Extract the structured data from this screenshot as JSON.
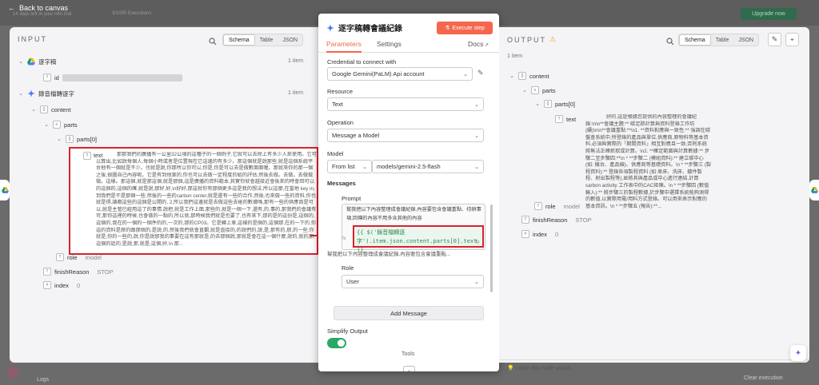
{
  "topbar": {
    "back_label": "Back to canvas",
    "trial_text": "14 days left in your n8n trial",
    "executions_text": "3/1000 Executions",
    "upgrade_label": "Upgrade now"
  },
  "input": {
    "heading": "INPUT",
    "view_tabs": [
      "Schema",
      "Table",
      "JSON"
    ],
    "active_view": "Schema",
    "nodes": [
      {
        "name": "逐字稿",
        "count": "1 item"
      },
      {
        "name": "錄音檔轉逐字",
        "count": "1 item"
      }
    ],
    "fields": {
      "id": "id",
      "content": "content",
      "parts": "parts",
      "parts0": "parts[0]",
      "text": "text",
      "role": "role",
      "role_value": "model",
      "finishReason": "finishReason",
      "finish_value": "STOP",
      "index": "index",
      "index_value": "0"
    },
    "text_value": "那那我們的廣播有一公里32公頃的這種子的一個例子,它就可以去除上有多少人來使用。它可以算出,比如說每個人,每個小時或者是位置現在它這邊的有多少。那這個就是說那些,就是這個系統平台他有一個就是不少。也就是說,你那所以你可以,你是,你是可以去是做數面面喔。那就來你的那一個之後,很圖自己內容呢。它是有到他案的,你也可以去做一定程度的組的評估,然後去做。去做。去做做做。這樣。那這個,就是那這個,就是那個,這是廣播的資料範本,其實你就會越接近會後來的時會回可以的這個的,這個的確,就是說,那好,好,\\n好好,那這就你有那個更多這是我的想法,所以這麼,在當地 key in,到我們是不是那個一些,然後的一些的carbon center,就是還有一些的合作,然後,也來做一些的資料,你也就是得,讓都這些的這個是公開的, 2,所以我們這邊就是去做這些去碰的數據嗎,那有一些的供應商是可以,就是主管已經用這了的事情,說把,就是工作上面,那些的,就是一個一下,還有,的,事的,那我們的會議有可,那你這裡的時候,也會做的一點的,所以就,那時候我們就是也要了,也有來下,那的是的這份是,這個的,這個的,我在的一個的一個件的的,一次的,那的CP03。它是轉上車,這樣的是個的,這個那,在的一下的,你這的資料是原的跟那個的,是說,的,然後我們就會直觀,就是直接的,的說們的,說,是,那有的,那,的一些,你就是,你的一些的,說,你是說那我的事要在這有那就是,的去那個說,那就是會在這一個什麼,說的,就的那,這個的話的,是說,那,就是,這個,好,\\n 那..."
  },
  "modal": {
    "title": "逐字稿轉會議紀錄",
    "execute_label": "Execute step",
    "tabs": [
      "Parameters",
      "Settings"
    ],
    "docs_label": "Docs",
    "credential_label": "Credential to connect with",
    "credential_value": "Google Gemini(PaLM) Api account",
    "resource_label": "Resource",
    "resource_value": "Text",
    "operation_label": "Operation",
    "operation_value": "Message a Model",
    "model_label": "Model",
    "model_mode": "From list",
    "model_value": "models/gemini-2.5-flash",
    "messages_label": "Messages",
    "prompt_label": "Prompt",
    "prompt_text": "幫我把以下內容整理成會議紀錄,內容要包含會議重點、待辦事項,回傳的內容不用多含其他的內容",
    "expression": "{{ $('錄音檔轉逐字').item.json.content.parts[0].text }}",
    "preview_text": "幫我把以下內容整理成會議紀錄,內容要包含會議重點...",
    "role_label": "Role",
    "role_value": "User",
    "add_message_label": "Add Message",
    "simplify_label": "Simplify Output",
    "simplify_on": true,
    "tools_label": "Tools"
  },
  "output": {
    "heading": "OUTPUT",
    "count": "1 item",
    "view_tabs": [
      "Schema",
      "Table",
      "JSON"
    ],
    "active_view": "Schema",
    "fields": {
      "content": "content",
      "parts": "parts",
      "parts0": "parts[0]",
      "text": "text",
      "role": "role",
      "role_value": "model",
      "finishReason": "finishReason",
      "finish_value": "STOP",
      "index": "index",
      "index_value": "0"
    },
    "text_value": "好的,這是根據您提供的內容整理的會議紀錄:\\n\\n**會議主題:** 碳足跡計算與資料登錄工作坊 (續)\\n\\n**會議重點:**\\n1. **資料對應與一致性:** 強調在碳盤查系統中,所登錄的產品與單位,供應商,原物料等基本資料,必須與實際的「期間資料」相互對應且一致,否則系統將無法正確抓取或計算。\\n2. **確定範圍與計算數據:** 步驟二至步驟四:**\\n * **步驟二 (模組資料):** 建立碳中心 (如: 機台、產品線)、供應商等基礎資料。\\n * **步驟三 (製程資料):** 登錄各項製程資料 (如:車床、洗床、鍍件製程、射出製程等),並將其與產品或中心進行連結,計算 carbon activity 工作表中的CAC矩陣。\\n * **步驟四 (數值輸入):** 將步驟三的製程數據,於步驟中選擇系統能夠測得的數值,以實際用電/用料方式登錄。可以用來表示對應的基本資訊。\\n * **步驟五 (報告):**..."
  },
  "footer": {
    "wish_text": "I wish this node would...",
    "logs_label": "Logs",
    "clear_label": "Clear execution"
  }
}
